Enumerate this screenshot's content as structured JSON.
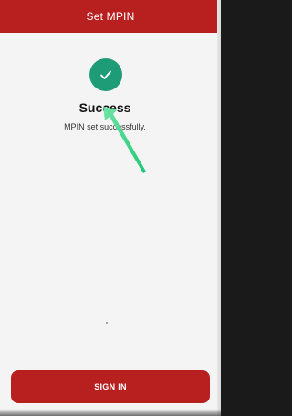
{
  "header": {
    "title": "Set MPIN"
  },
  "status": {
    "icon": "check-icon",
    "title": "Success",
    "message": "MPIN set successfully."
  },
  "actions": {
    "sign_in_label": "SIGN IN"
  },
  "colors": {
    "brand": "#b81f1f",
    "success": "#1e9b77",
    "annotation_arrow": "#2ed47a",
    "background": "#f4f4f4"
  }
}
